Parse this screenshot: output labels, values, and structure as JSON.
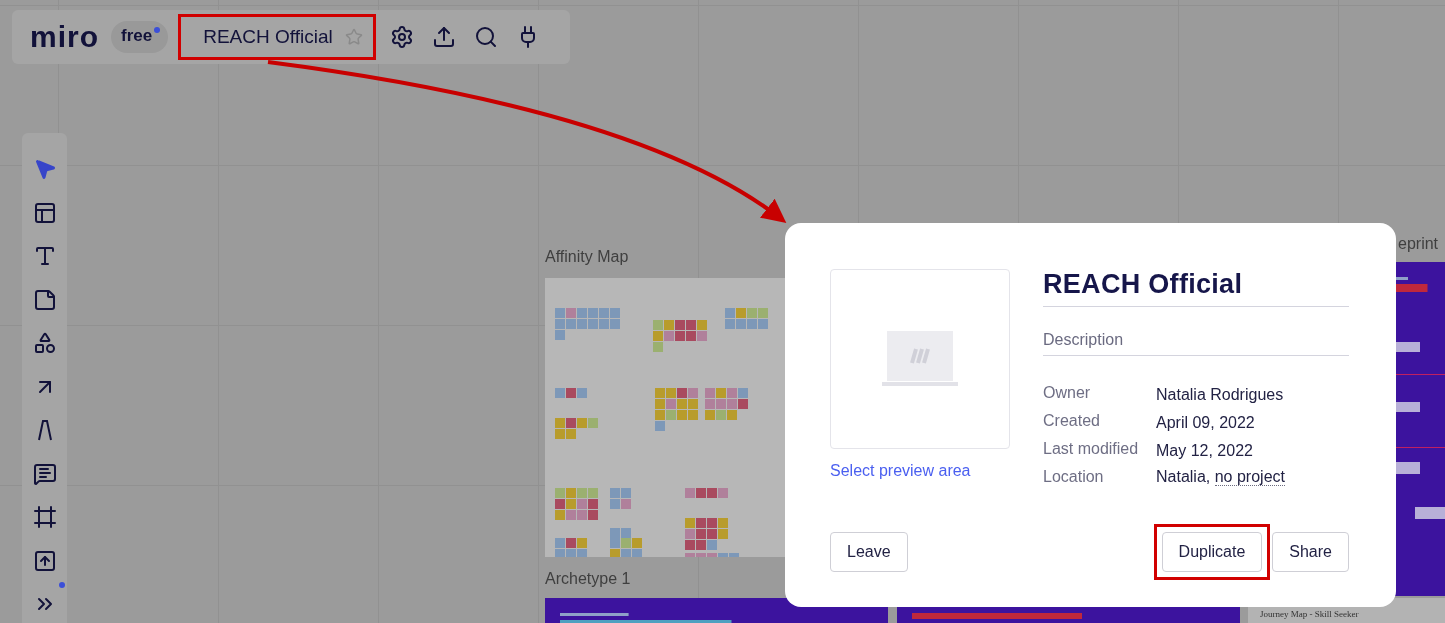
{
  "toolbar": {
    "logo": "miro",
    "plan": "free",
    "plan_dot": true,
    "board_title": "REACH Official",
    "starred": false,
    "highlighted": true
  },
  "tools": [
    {
      "selected": true
    },
    {
      "selected": false
    },
    {
      "selected": false
    },
    {
      "selected": false
    },
    {
      "selected": false
    },
    {
      "selected": false
    },
    {
      "selected": false
    },
    {
      "selected": false
    },
    {
      "selected": false
    },
    {
      "selected": false
    },
    {
      "selected": false
    }
  ],
  "more_tools_badge": true,
  "canvas": {
    "frame_labels": [
      "Affinity Map",
      "Archetype 1",
      "eprint"
    ],
    "journey_label": "Journey Map - Skill Seeker"
  },
  "dialog": {
    "title": "REACH Official",
    "description_placeholder": "Description",
    "preview_link": "Select preview area",
    "details": [
      {
        "label": "Owner",
        "value": "Natalia Rodrigues"
      },
      {
        "label": "Created",
        "value": "April 09, 2022"
      },
      {
        "label": "Last modified",
        "value": "May 12, 2022"
      },
      {
        "label": "Location",
        "value": "Natalia,",
        "link": "no project"
      }
    ],
    "buttons": [
      {
        "label": "Leave",
        "highlighted": false
      },
      {
        "label": "Duplicate",
        "highlighted": true
      },
      {
        "label": "Share",
        "highlighted": false
      }
    ]
  }
}
